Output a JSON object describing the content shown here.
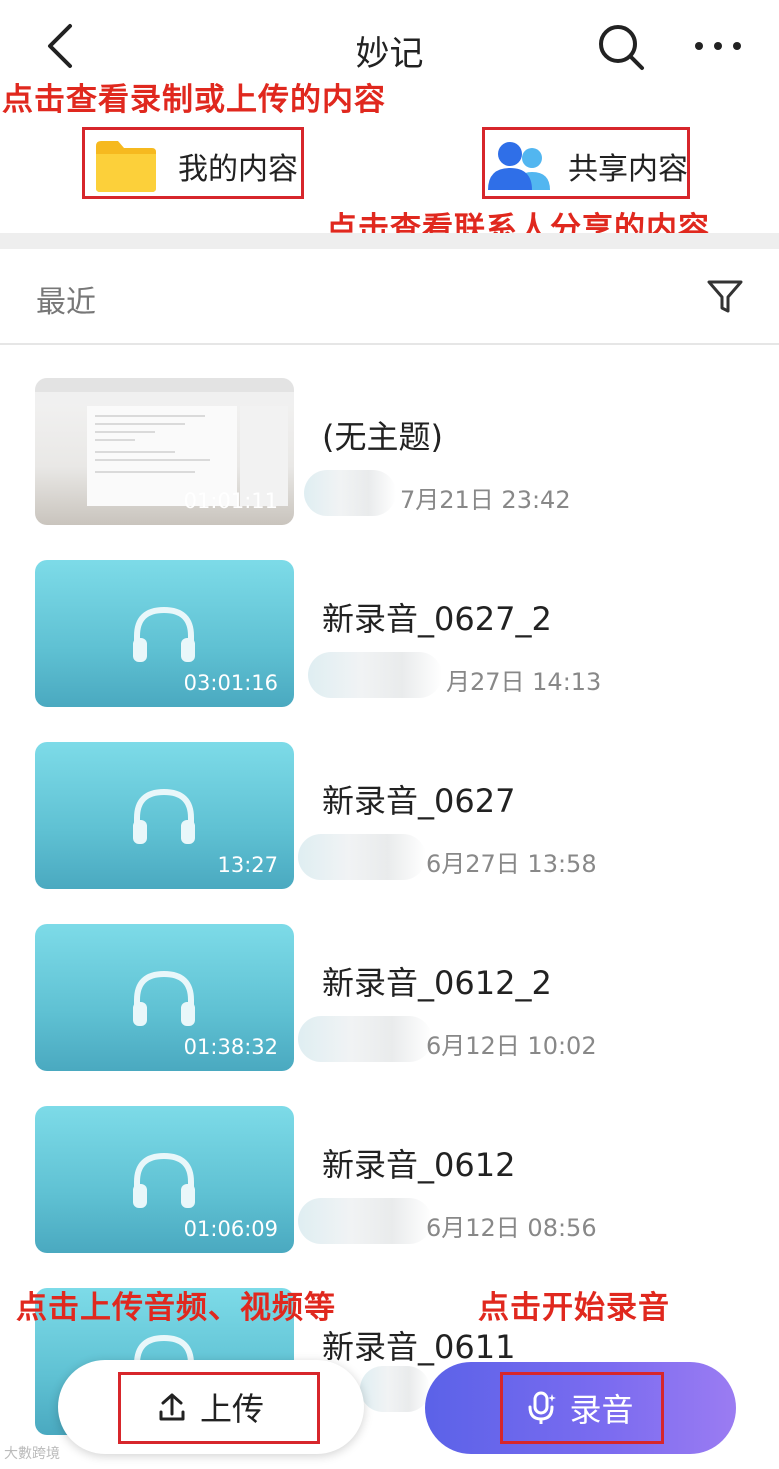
{
  "header": {
    "title": "妙记",
    "back_icon": "chevron-left-icon",
    "search_icon": "search-icon",
    "more_icon": "more-horizontal-icon"
  },
  "annotations": {
    "top": "点击查看录制或上传的内容",
    "shared": "点击查看联系人分享的内容",
    "upload": "点击上传音频、视频等",
    "record": "点击开始录音"
  },
  "quick_access": {
    "my_content": {
      "label": "我的内容",
      "icon": "folder-icon",
      "color": "#f5c52a"
    },
    "shared_content": {
      "label": "共享内容",
      "icon": "people-icon",
      "color": "#3a7bf2"
    }
  },
  "recent": {
    "label": "最近",
    "filter_icon": "filter-icon"
  },
  "items": [
    {
      "name": "(无主题)",
      "date": "7月21日 23:42",
      "duration": "01:01:11",
      "thumb": "document"
    },
    {
      "name": "新录音_0627_2",
      "date": "月27日 14:13",
      "duration": "03:01:16",
      "thumb": "audio"
    },
    {
      "name": "新录音_0627",
      "date": "6月27日 13:58",
      "duration": "13:27",
      "thumb": "audio"
    },
    {
      "name": "新录音_0612_2",
      "date": "6月12日 10:02",
      "duration": "01:38:32",
      "thumb": "audio"
    },
    {
      "name": "新录音_0612",
      "date": "6月12日 08:56",
      "duration": "01:06:09",
      "thumb": "audio"
    },
    {
      "name": "新录音_0611",
      "date": "",
      "duration": "",
      "thumb": "audio"
    }
  ],
  "bottom": {
    "upload_label": "上传",
    "upload_icon": "upload-icon",
    "record_label": "录音",
    "record_icon": "microphone-icon"
  },
  "watermark": "大數跨境"
}
